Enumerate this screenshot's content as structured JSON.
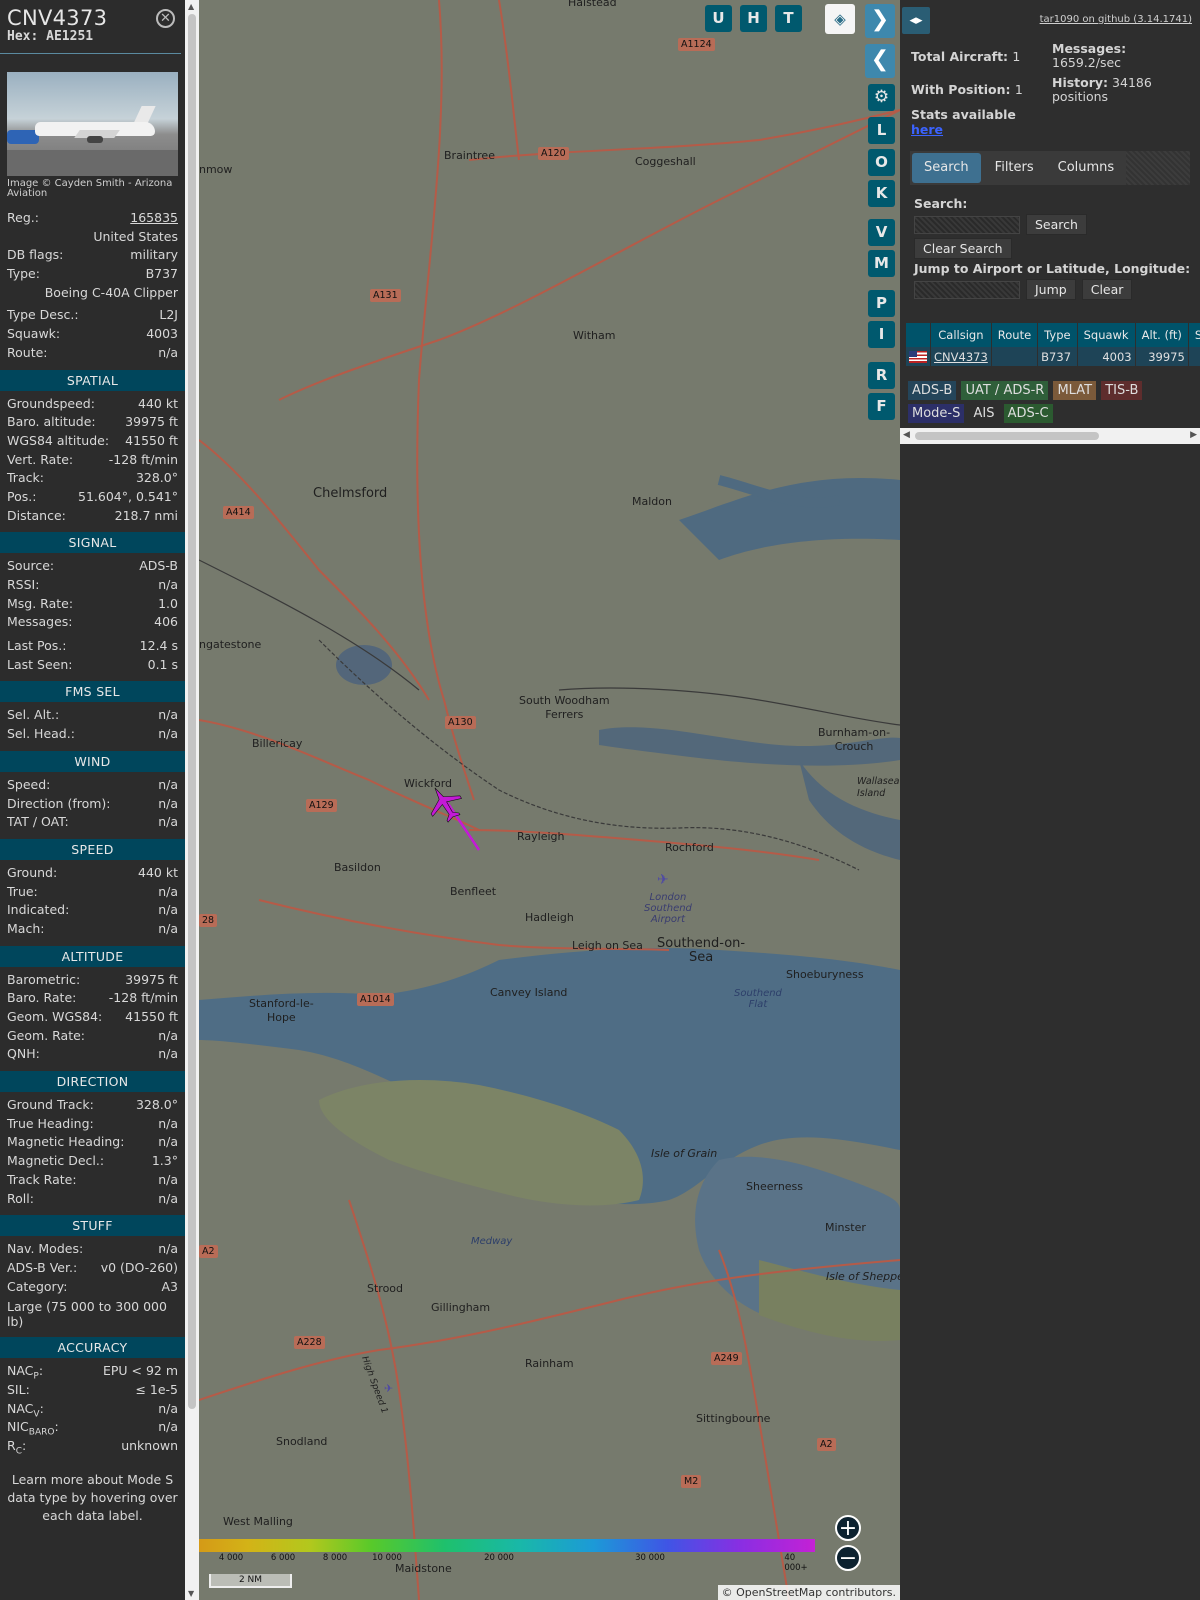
{
  "info": {
    "callsign": "CNV4373",
    "hex": "Hex: AE1251",
    "photo_credit": "Image © Cayden Smith - Arizona Aviation",
    "rows_top": [
      {
        "label": "Reg.:",
        "value": "165835"
      },
      {
        "label": "",
        "value": "United States"
      },
      {
        "label": "DB flags:",
        "value": "military"
      },
      {
        "label": "Type:",
        "value": "B737"
      },
      {
        "label": "",
        "value": "Boeing C-40A Clipper"
      },
      {
        "label": "Type Desc.:",
        "value": "L2J"
      },
      {
        "label": "Squawk:",
        "value": "4003"
      },
      {
        "label": "Route:",
        "value": "n/a"
      }
    ],
    "sections": {
      "spatial": {
        "title": "SPATIAL",
        "rows": [
          {
            "label": "Groundspeed:",
            "value": "440 kt"
          },
          {
            "label": "Baro. altitude:",
            "value": "39975 ft"
          },
          {
            "label": "WGS84 altitude:",
            "value": "41550 ft"
          },
          {
            "label": "Vert. Rate:",
            "value": "-128 ft/min"
          },
          {
            "label": "Track:",
            "value": "328.0°"
          },
          {
            "label": "Pos.:",
            "value": "51.604°, 0.541°"
          },
          {
            "label": "Distance:",
            "value": "218.7 nmi"
          }
        ]
      },
      "signal": {
        "title": "SIGNAL",
        "rows": [
          {
            "label": "Source:",
            "value": "ADS-B"
          },
          {
            "label": "RSSI:",
            "value": "n/a"
          },
          {
            "label": "Msg. Rate:",
            "value": "1.0"
          },
          {
            "label": "Messages:",
            "value": "406"
          },
          {
            "label": "Last Pos.:",
            "value": "12.4 s"
          },
          {
            "label": "Last Seen:",
            "value": "0.1 s"
          }
        ]
      },
      "fms": {
        "title": "FMS SEL",
        "rows": [
          {
            "label": "Sel. Alt.:",
            "value": "n/a"
          },
          {
            "label": "Sel. Head.:",
            "value": "n/a"
          }
        ]
      },
      "wind": {
        "title": "WIND",
        "rows": [
          {
            "label": "Speed:",
            "value": "n/a"
          },
          {
            "label": "Direction (from):",
            "value": "n/a"
          },
          {
            "label": "TAT / OAT:",
            "value": "n/a"
          }
        ]
      },
      "speed": {
        "title": "SPEED",
        "rows": [
          {
            "label": "Ground:",
            "value": "440 kt"
          },
          {
            "label": "True:",
            "value": "n/a"
          },
          {
            "label": "Indicated:",
            "value": "n/a"
          },
          {
            "label": "Mach:",
            "value": "n/a"
          }
        ]
      },
      "altitude": {
        "title": "ALTITUDE",
        "rows": [
          {
            "label": "Barometric:",
            "value": "39975 ft"
          },
          {
            "label": "Baro. Rate:",
            "value": "-128 ft/min"
          },
          {
            "label": "Geom. WGS84:",
            "value": "41550 ft"
          },
          {
            "label": "Geom. Rate:",
            "value": "n/a"
          },
          {
            "label": "QNH:",
            "value": "n/a"
          }
        ]
      },
      "direction": {
        "title": "DIRECTION",
        "rows": [
          {
            "label": "Ground Track:",
            "value": "328.0°"
          },
          {
            "label": "True Heading:",
            "value": "n/a"
          },
          {
            "label": "Magnetic Heading:",
            "value": "n/a"
          },
          {
            "label": "Magnetic Decl.:",
            "value": "1.3°"
          },
          {
            "label": "Track Rate:",
            "value": "n/a"
          },
          {
            "label": "Roll:",
            "value": "n/a"
          }
        ]
      },
      "stuff": {
        "title": "STUFF",
        "rows": [
          {
            "label": "Nav. Modes:",
            "value": "n/a"
          },
          {
            "label": "ADS-B Ver.:",
            "value": "v0 (DO-260)"
          },
          {
            "label": "Category:",
            "value": "A3"
          }
        ],
        "category_desc": "Large (75 000 to 300 000 lb)"
      },
      "accuracy": {
        "title": "ACCURACY",
        "rows": [
          {
            "label": "NAC",
            "sub": "P",
            "value": "EPU < 92 m"
          },
          {
            "label": "SIL:",
            "sub": "",
            "value": "≤ 1e-5"
          },
          {
            "label": "NAC",
            "sub": "V",
            "value": "n/a"
          },
          {
            "label": "NIC",
            "sub": "BARO",
            "value": "n/a"
          },
          {
            "label": "R",
            "sub": "C",
            "value": "unknown"
          }
        ]
      }
    },
    "learn_more": "Learn more about Mode S data type by hovering over each data label."
  },
  "map": {
    "buttons": {
      "u": "U",
      "h": "H",
      "t": "T",
      "l": "L",
      "o": "O",
      "k": "K",
      "v": "V",
      "m": "M",
      "p": "P",
      "i": "I",
      "r": "R",
      "f": "F"
    },
    "places": {
      "halstead": "Halstead",
      "braintree": "Braintree",
      "coggeshall": "Coggeshall",
      "witham": "Witham",
      "chelmsford": "Chelmsford",
      "maldon": "Maldon",
      "ingatestone": "ngatestone",
      "south_woodham": "South Woodham\nFerrers",
      "burnham": "Burnham-on-\nCrouch",
      "wallasea": "Wallasea\nIsland",
      "billericay": "Billericay",
      "wickford": "Wickford",
      "rayleigh": "Rayleigh",
      "rochford": "Rochford",
      "basildon": "Basildon",
      "benfleet": "Benfleet",
      "hadleigh": "Hadleigh",
      "leigh": "Leigh on Sea",
      "southend": "Southend-on-\nSea",
      "shoeburyness": "Shoeburyness",
      "canvey": "Canvey Island",
      "stanford": "Stanford-le-\nHope",
      "isle_of_grain": "Isle of Grain",
      "sheerness": "Sheerness",
      "minster": "Minster",
      "isle_of_sheppey": "Isle of Sheppe",
      "strood": "Strood",
      "gillingham": "Gillingham",
      "rainham": "Rainham",
      "sittingbourne": "Sittingbourne",
      "snodland": "Snodland",
      "west_malling": "West Malling",
      "maidstone": "Maidstone",
      "nmow": "nmow",
      "airport": "London\nSouthend\nAirport",
      "southend_flat": "Southend\nFlat",
      "medway": "Medway",
      "hs1": "High Speed 1"
    },
    "roads": {
      "a1124": "A1124",
      "a120": "A120",
      "a131": "A131",
      "a414": "A414",
      "a130": "A130",
      "a129": "A129",
      "a1014": "A1014",
      "a2": "A2",
      "a228": "A228",
      "a249": "A249",
      "a2b": "A2",
      "m2": "M2",
      "a28": "28",
      "a2c": "A2"
    },
    "altitude_scale": [
      "4 000",
      "6 000",
      "8 000",
      "10 000",
      "20 000",
      "30 000",
      "40 000+"
    ],
    "scale_bar": "2 NM",
    "attribution": "© OpenStreetMap contributors.",
    "colors": {
      "track": "#c41ad6",
      "aircraft": "#c41ad6"
    }
  },
  "right": {
    "github": "tar1090 on github (3.14.1741)",
    "total_aircraft_label": "Total Aircraft:",
    "total_aircraft": "1",
    "with_position_label": "With Position:",
    "with_position": "1",
    "stats_available": "Stats available",
    "here": "here",
    "messages_label": "Messages:",
    "messages_rate": "1659.2/sec",
    "history_label": "History:",
    "history_value": "34186",
    "history_unit": "positions",
    "tabs": [
      "Search",
      "Filters",
      "Columns"
    ],
    "search_label": "Search:",
    "search_button": "Search",
    "clear_search": "Clear Search",
    "jump_label": "Jump to Airport or Latitude, Longitude:",
    "jump_button": "Jump",
    "clear_button": "Clear",
    "table": {
      "headers": [
        "",
        "Callsign",
        "Route",
        "Type",
        "Squawk",
        "Alt. (ft)",
        "Spe"
      ],
      "rows": [
        {
          "callsign": "CNV4373",
          "route": "",
          "type": "B737",
          "squawk": "4003",
          "alt": "39975",
          "speed": ""
        }
      ]
    },
    "legend": [
      "ADS-B",
      "UAT / ADS-R",
      "MLAT",
      "TIS-B",
      "Mode-S",
      "AIS",
      "ADS-C"
    ]
  }
}
